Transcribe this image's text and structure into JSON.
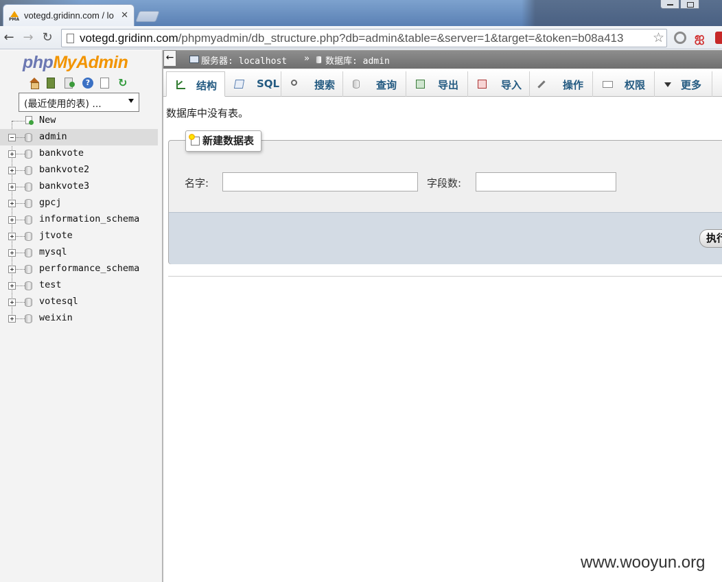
{
  "browser": {
    "tab_title": "votegd.gridinn.com / lo",
    "url_host": "votegd.gridinn.com",
    "url_path": "/phpmyadmin/db_structure.php?db=admin&table=&server=1&target=&token=b08a413"
  },
  "sidebar": {
    "logo_php": "php",
    "logo_my": "My",
    "logo_admin": "Admin",
    "recent_select": "(最近使用的表) ...",
    "new_label": "New",
    "databases": [
      {
        "name": "admin",
        "selected": true
      },
      {
        "name": "bankvote"
      },
      {
        "name": "bankvote2"
      },
      {
        "name": "bankvote3"
      },
      {
        "name": "gpcj"
      },
      {
        "name": "information_schema"
      },
      {
        "name": "jtvote"
      },
      {
        "name": "mysql"
      },
      {
        "name": "performance_schema"
      },
      {
        "name": "test"
      },
      {
        "name": "votesql"
      },
      {
        "name": "weixin"
      }
    ]
  },
  "breadcrumb": {
    "server": "服务器: localhost",
    "separator": "»",
    "database": "数据库: admin"
  },
  "tabs": [
    {
      "label": "结构",
      "icon": "structure-icon"
    },
    {
      "label": "SQL",
      "icon": "sql-icon"
    },
    {
      "label": "搜索",
      "icon": "search-icon"
    },
    {
      "label": "查询",
      "icon": "query-icon"
    },
    {
      "label": "导出",
      "icon": "export-icon"
    },
    {
      "label": "导入",
      "icon": "import-icon"
    },
    {
      "label": "操作",
      "icon": "operations-icon"
    },
    {
      "label": "权限",
      "icon": "privileges-icon"
    },
    {
      "label": "更多",
      "icon": "more-icon"
    }
  ],
  "main": {
    "notice": "数据库中没有表。",
    "create_table": {
      "legend": "新建数据表",
      "name_label": "名字:",
      "name_value": "",
      "columns_label": "字段数:",
      "columns_value": "",
      "go_label": "执行"
    }
  },
  "watermark": "www.wooyun.org"
}
